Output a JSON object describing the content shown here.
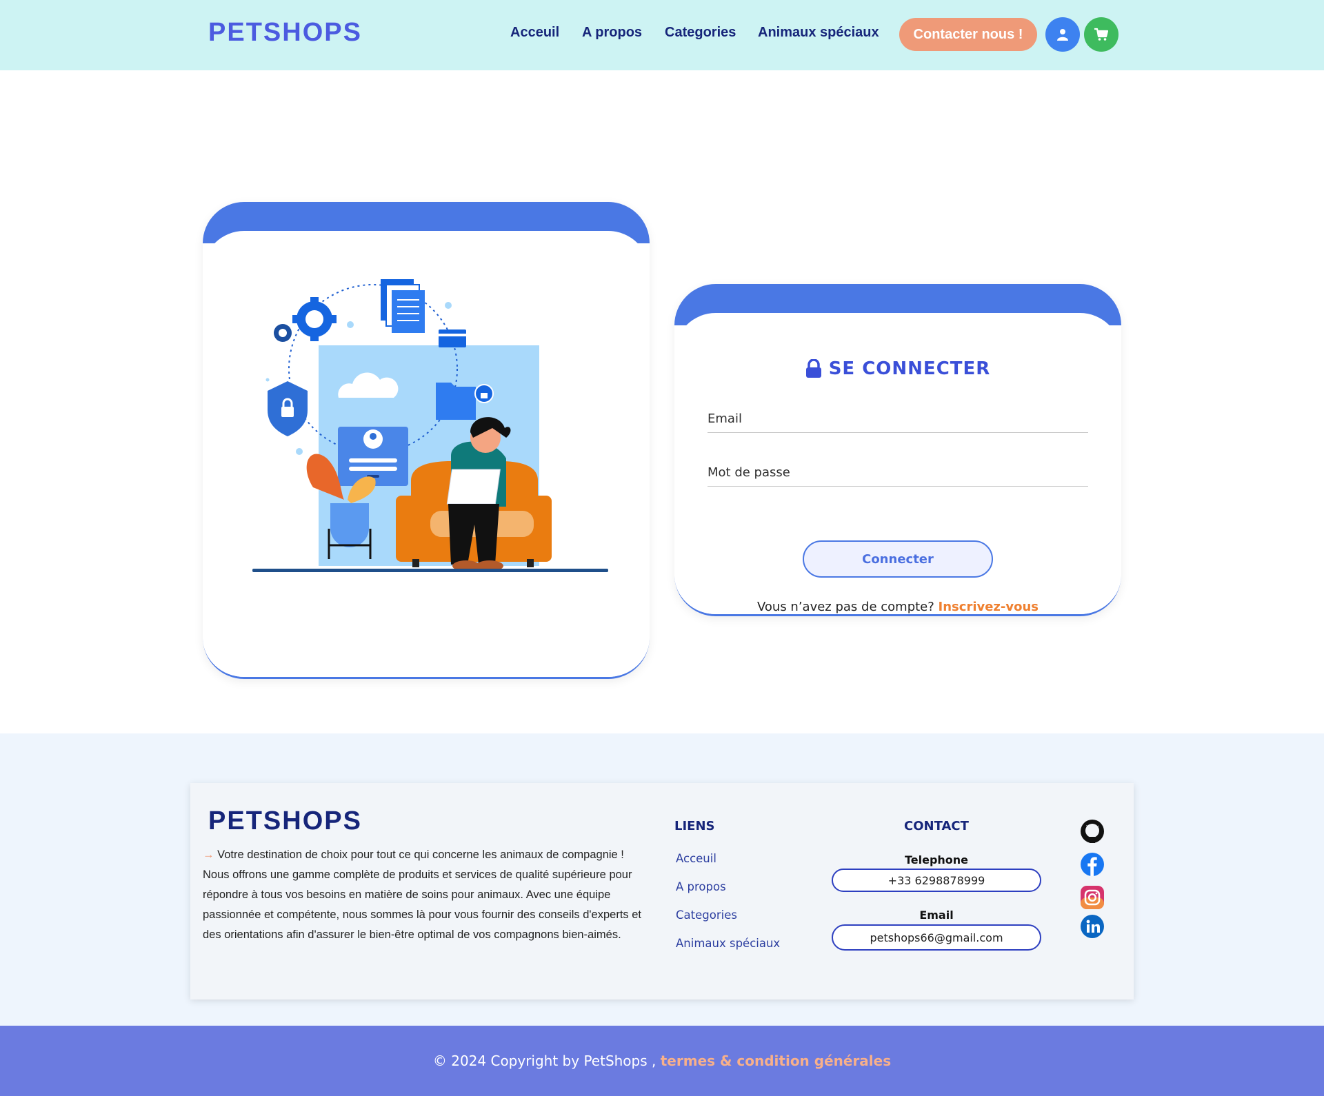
{
  "header": {
    "logo": "PETSHOPS",
    "nav": [
      "Acceuil",
      "A propos",
      "Categories",
      "Animaux spéciaux"
    ],
    "contact_button": "Contacter nous !",
    "user_icon": "user-icon",
    "cart_icon": "cart-icon"
  },
  "login": {
    "title": "SE CONNECTER",
    "lock_icon": "lock-icon",
    "email_placeholder": "Email",
    "password_placeholder": "Mot de passe",
    "submit_label": "Connecter",
    "no_account_text": "Vous n’avez pas de compte?",
    "signup_link": "Inscrivez-vous"
  },
  "footer": {
    "logo": "PETSHOPS",
    "arrow": "→",
    "description": "Votre destination de choix pour tout ce qui concerne les animaux de compagnie ! Nous offrons une gamme complète de produits et services de qualité supérieure pour répondre à tous vos besoins en matière de soins pour animaux. Avec une équipe passionnée et compétente, nous sommes là pour vous fournir des conseils d'experts et des orientations afin d'assurer le bien-être optimal de vos compagnons bien-aimés.",
    "links_title": "LIENS",
    "links": [
      "Acceuil",
      "A propos",
      "Categories",
      "Animaux spéciaux"
    ],
    "contact_title": "CONTACT",
    "phone_label": "Telephone",
    "phone_value": "+33 6298878999",
    "email_label": "Email",
    "email_value": "petshops66@gmail.com",
    "socials": [
      "github-icon",
      "facebook-icon",
      "instagram-icon",
      "linkedin-icon"
    ]
  },
  "bottom": {
    "copyright": "© 2024 Copyright by PetShops ,",
    "terms": "termes & condition générales"
  },
  "colors": {
    "header_bg": "#cdf3f3",
    "brand_blue": "#4a78e4",
    "accent_orange": "#ef9a78",
    "bottom_bar": "#6b7be0"
  }
}
